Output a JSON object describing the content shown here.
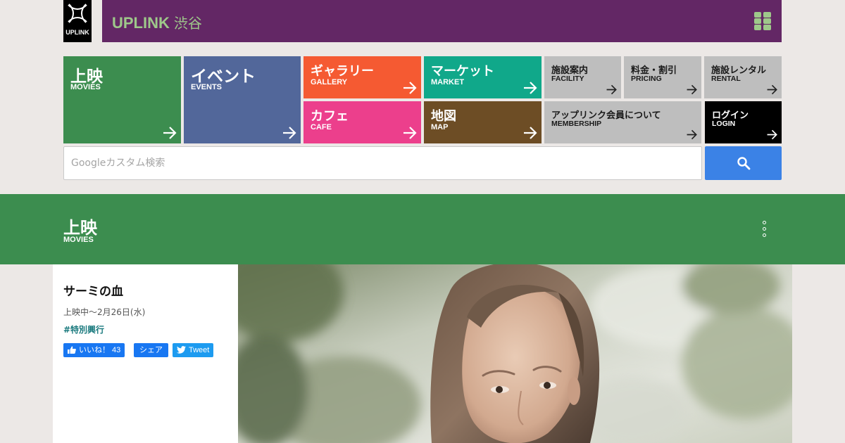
{
  "header": {
    "logo_text": "UPLINK",
    "brand": "UPLINK",
    "brand_sub": "渋谷",
    "brand_color": "#632765",
    "accent_color": "#9ec88a",
    "menu_icon": "grid-icon"
  },
  "nav": {
    "movies": {
      "jp": "上映",
      "en": "MOVIES",
      "color": "#3c8d4f"
    },
    "events": {
      "jp": "イベント",
      "en": "EVENTS",
      "color": "#52679a"
    },
    "gallery": {
      "jp": "ギャラリー",
      "en": "GALLERY",
      "color": "#f55a32"
    },
    "market": {
      "jp": "マーケット",
      "en": "MARKET",
      "color": "#10a88a"
    },
    "cafe": {
      "jp": "カフェ",
      "en": "CAFE",
      "color": "#ec3f8c"
    },
    "map": {
      "jp": "地図",
      "en": "MAP",
      "color": "#6d4d25"
    },
    "facility": {
      "jp": "施設案内",
      "en": "FACILITY"
    },
    "pricing": {
      "jp": "料金・割引",
      "en": "PRICING"
    },
    "rental": {
      "jp": "施設レンタル",
      "en": "RENTAL"
    },
    "membership": {
      "jp": "アップリンク会員について",
      "en": "MEMBERSHIP"
    },
    "login": {
      "jp": "ログイン",
      "en": "LOGIN"
    },
    "arrow_icon": "arrow-right-icon"
  },
  "search": {
    "placeholder": "Googleカスタム検索",
    "value": "",
    "button_icon": "search-icon",
    "button_color": "#3b82e6"
  },
  "section": {
    "title_jp": "上映",
    "title_en": "MOVIES",
    "menu_icon": "kebab-menu-icon"
  },
  "film": {
    "title": "サーミの血",
    "dates": "上映中～2月26日(水)",
    "tag": "#特別興行",
    "like_label": "いいね！ 43",
    "share_label": "シェア",
    "tweet_label": "Tweet"
  }
}
